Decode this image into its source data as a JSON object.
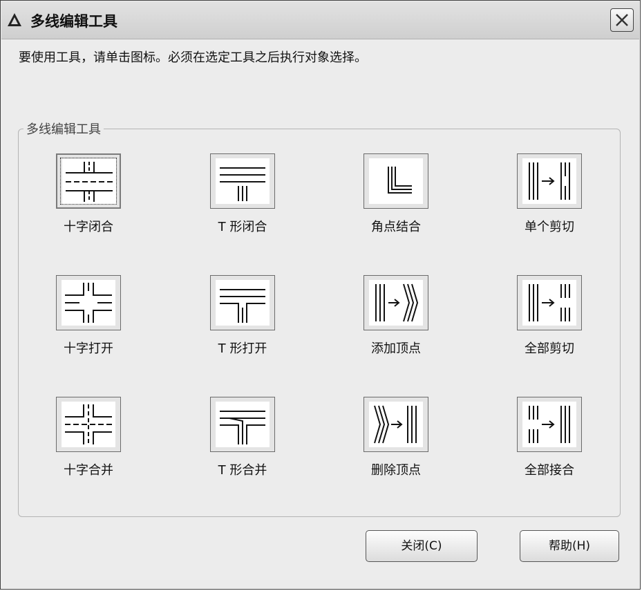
{
  "window": {
    "title": "多线编辑工具",
    "app_icon": "autocad-logo-icon",
    "close_icon": "close-icon"
  },
  "instruction": "要使用工具，请单击图标。必须在选定工具之后执行对象选择。",
  "group": {
    "label": "多线编辑工具",
    "tools": [
      {
        "label": "十字闭合",
        "icon": "cross-closed-icon",
        "selected": true
      },
      {
        "label": "T 形闭合",
        "icon": "tee-closed-icon"
      },
      {
        "label": "角点结合",
        "icon": "corner-joint-icon"
      },
      {
        "label": "单个剪切",
        "icon": "cut-single-icon"
      },
      {
        "label": "十字打开",
        "icon": "cross-open-icon"
      },
      {
        "label": "T 形打开",
        "icon": "tee-open-icon"
      },
      {
        "label": "添加顶点",
        "icon": "add-vertex-icon"
      },
      {
        "label": "全部剪切",
        "icon": "cut-all-icon"
      },
      {
        "label": "十字合并",
        "icon": "cross-merged-icon"
      },
      {
        "label": "T 形合并",
        "icon": "tee-merged-icon"
      },
      {
        "label": "删除顶点",
        "icon": "delete-vertex-icon"
      },
      {
        "label": "全部接合",
        "icon": "weld-all-icon"
      }
    ]
  },
  "buttons": {
    "close": "关闭(C)",
    "help": "帮助(H)"
  }
}
